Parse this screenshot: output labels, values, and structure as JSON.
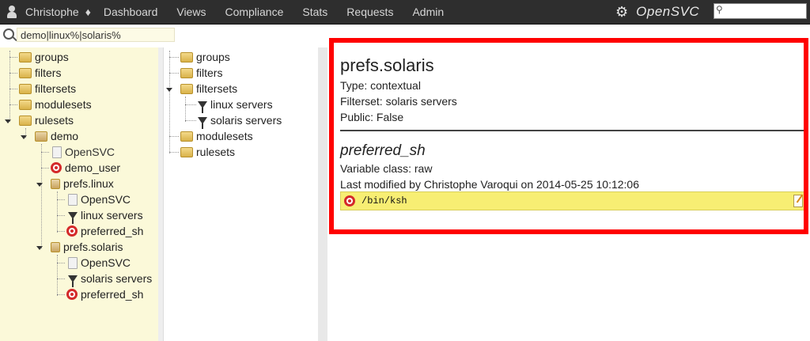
{
  "topbar": {
    "user": "Christophe",
    "nav": [
      "Dashboard",
      "Views",
      "Compliance",
      "Stats",
      "Requests",
      "Admin"
    ],
    "brand": "OpenSVC",
    "search_value": ""
  },
  "filter": {
    "value": "demo|linux%|solaris%"
  },
  "left_tree": {
    "groups": "groups",
    "filters": "filters",
    "filtersets": "filtersets",
    "modulesets": "modulesets",
    "rulesets": "rulesets",
    "demo": "demo",
    "demo_opensvc": "OpenSVC",
    "demo_user": "demo_user",
    "prefs_linux": "prefs.linux",
    "pl_opensvc": "OpenSVC",
    "pl_linux_servers": "linux servers",
    "pl_preferred_sh": "preferred_sh",
    "prefs_solaris": "prefs.solaris",
    "ps_opensvc": "OpenSVC",
    "ps_solaris_servers": "solaris servers",
    "ps_preferred_sh": "preferred_sh"
  },
  "mid_tree": {
    "groups": "groups",
    "filters": "filters",
    "filtersets": "filtersets",
    "linux_servers": "linux servers",
    "solaris_servers": "solaris servers",
    "modulesets": "modulesets",
    "rulesets": "rulesets"
  },
  "detail": {
    "title": "prefs.solaris",
    "type": "Type: contextual",
    "filterset": "Filterset: solaris servers",
    "public": "Public: False",
    "variable_name": "preferred_sh",
    "variable_class": "Variable class: raw",
    "last_modified": "Last modified by Christophe Varoqui on 2014-05-25 10:12:06",
    "value": "/bin/ksh"
  }
}
